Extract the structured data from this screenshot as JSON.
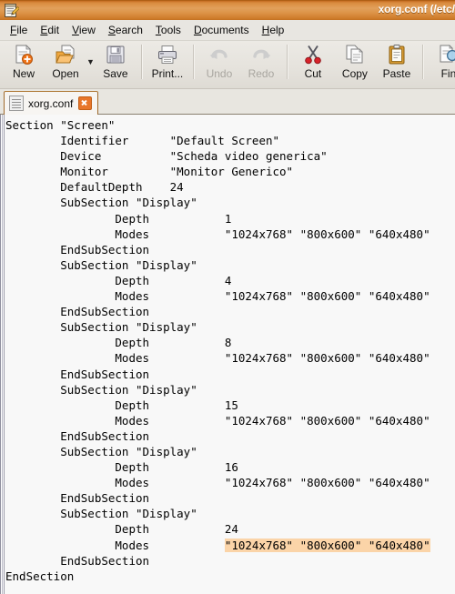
{
  "window": {
    "title": "xorg.conf (/etc/",
    "icon": "gedit-icon"
  },
  "menubar": {
    "items": [
      {
        "label": "File",
        "mnemonic": "F"
      },
      {
        "label": "Edit",
        "mnemonic": "E"
      },
      {
        "label": "View",
        "mnemonic": "V"
      },
      {
        "label": "Search",
        "mnemonic": "S"
      },
      {
        "label": "Tools",
        "mnemonic": "T"
      },
      {
        "label": "Documents",
        "mnemonic": "D"
      },
      {
        "label": "Help",
        "mnemonic": "H"
      }
    ]
  },
  "toolbar": {
    "items": [
      {
        "label": "New",
        "icon": "new-document-icon",
        "disabled": false
      },
      {
        "label": "Open",
        "icon": "open-folder-icon",
        "disabled": false
      },
      {
        "label": "Save",
        "icon": "floppy-disk-icon",
        "disabled": false
      },
      {
        "label": "Print...",
        "icon": "printer-icon",
        "disabled": false
      },
      {
        "label": "Undo",
        "icon": "undo-arrow-icon",
        "disabled": true
      },
      {
        "label": "Redo",
        "icon": "redo-arrow-icon",
        "disabled": true
      },
      {
        "label": "Cut",
        "icon": "scissors-icon",
        "disabled": false
      },
      {
        "label": "Copy",
        "icon": "copy-pages-icon",
        "disabled": false
      },
      {
        "label": "Paste",
        "icon": "clipboard-icon",
        "disabled": false
      },
      {
        "label": "Fin",
        "icon": "find-magnifier-icon",
        "disabled": false
      }
    ],
    "open_dropdown_glyph": "▼"
  },
  "tabs": [
    {
      "label": "xorg.conf",
      "icon": "text-document-icon",
      "close_label": "×",
      "active": true
    }
  ],
  "editor": {
    "highlight_color": "#fbd4a8",
    "lines": [
      {
        "text": "Section \"Screen\"",
        "highlight": null
      },
      {
        "text": "        Identifier      \"Default Screen\"",
        "highlight": null
      },
      {
        "text": "        Device          \"Scheda video generica\"",
        "highlight": null
      },
      {
        "text": "        Monitor         \"Monitor Generico\"",
        "highlight": null
      },
      {
        "text": "        DefaultDepth    24",
        "highlight": null
      },
      {
        "text": "        SubSection \"Display\"",
        "highlight": null
      },
      {
        "text": "                Depth           1",
        "highlight": null
      },
      {
        "text": "                Modes           \"1024x768\" \"800x600\" \"640x480\"",
        "highlight": null
      },
      {
        "text": "        EndSubSection",
        "highlight": null
      },
      {
        "text": "        SubSection \"Display\"",
        "highlight": null
      },
      {
        "text": "                Depth           4",
        "highlight": null
      },
      {
        "text": "                Modes           \"1024x768\" \"800x600\" \"640x480\"",
        "highlight": null
      },
      {
        "text": "        EndSubSection",
        "highlight": null
      },
      {
        "text": "        SubSection \"Display\"",
        "highlight": null
      },
      {
        "text": "                Depth           8",
        "highlight": null
      },
      {
        "text": "                Modes           \"1024x768\" \"800x600\" \"640x480\"",
        "highlight": null
      },
      {
        "text": "        EndSubSection",
        "highlight": null
      },
      {
        "text": "        SubSection \"Display\"",
        "highlight": null
      },
      {
        "text": "                Depth           15",
        "highlight": null
      },
      {
        "text": "                Modes           \"1024x768\" \"800x600\" \"640x480\"",
        "highlight": null
      },
      {
        "text": "        EndSubSection",
        "highlight": null
      },
      {
        "text": "        SubSection \"Display\"",
        "highlight": null
      },
      {
        "text": "                Depth           16",
        "highlight": null
      },
      {
        "text": "                Modes           \"1024x768\" \"800x600\" \"640x480\"",
        "highlight": null
      },
      {
        "text": "        EndSubSection",
        "highlight": null
      },
      {
        "text": "        SubSection \"Display\"",
        "highlight": null
      },
      {
        "text": "                Depth           24",
        "highlight": null
      },
      {
        "text": "                Modes           ",
        "highlight": "\"1024x768\" \"800x600\" \"640x480\""
      },
      {
        "text": "        EndSubSection",
        "highlight": null
      },
      {
        "text": "EndSection",
        "highlight": null
      }
    ]
  }
}
